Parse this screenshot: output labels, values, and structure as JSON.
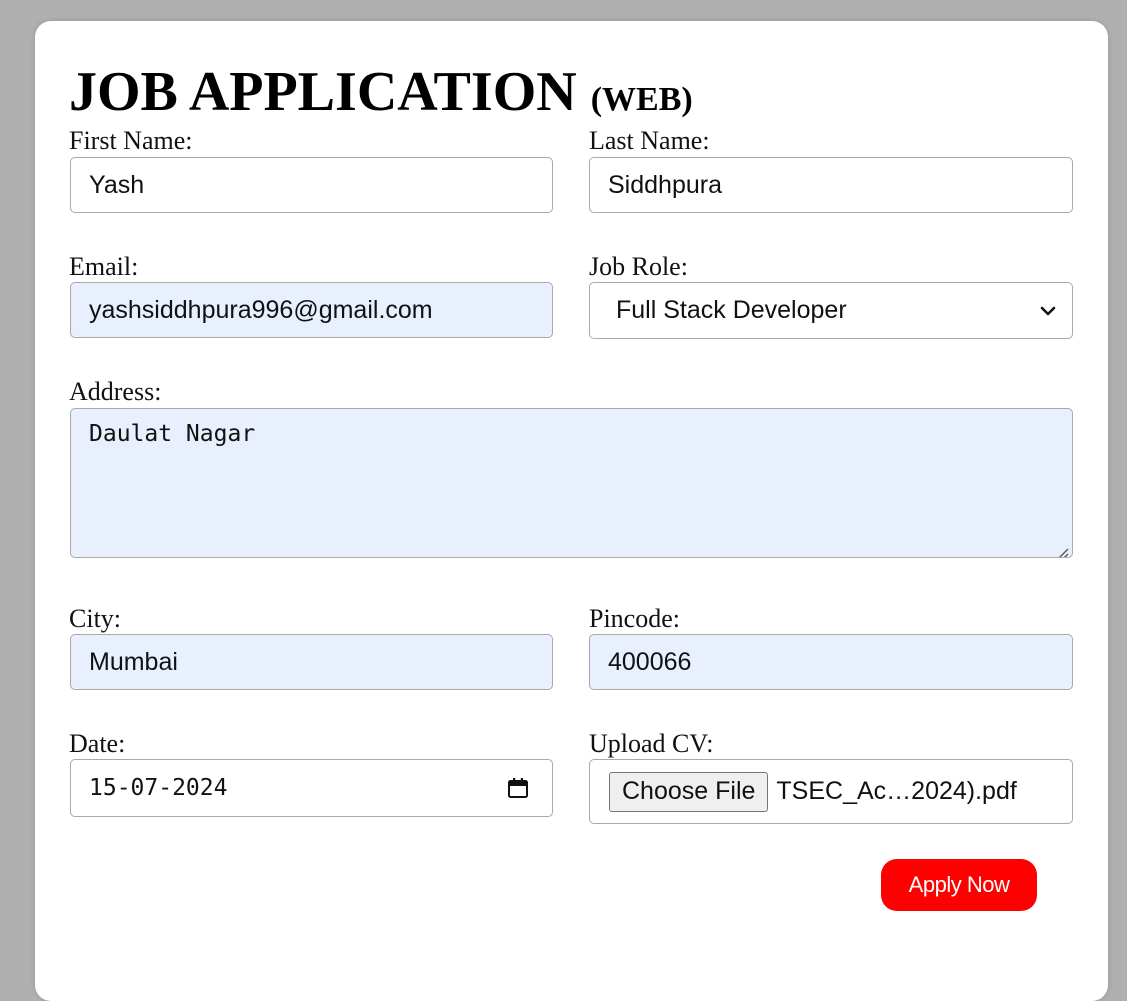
{
  "form": {
    "title": "JOB APPLICATION",
    "title_suffix": "(WEB)",
    "first_name": {
      "label": "First Name:",
      "value": "Yash"
    },
    "last_name": {
      "label": "Last Name:",
      "value": "Siddhpura"
    },
    "email": {
      "label": "Email:",
      "value": "yashsiddhpura996@gmail.com"
    },
    "job_role": {
      "label": "Job Role:",
      "selected": "Full Stack Developer"
    },
    "address": {
      "label": "Address:",
      "value": "Daulat Nagar"
    },
    "city": {
      "label": "City:",
      "value": "Mumbai"
    },
    "pincode": {
      "label": "Pincode:",
      "value": "400066"
    },
    "date": {
      "label": "Date:",
      "value": "15-07-2024"
    },
    "upload_cv": {
      "label": "Upload CV:",
      "button_label": "Choose File",
      "file_name": "TSEC_Ac…2024).pdf"
    },
    "submit_label": "Apply Now"
  },
  "colors": {
    "autofill_bg": "#e8f0fe",
    "submit_bg": "#ff0000",
    "page_bg": "#b1b0b1"
  },
  "icons": {
    "select_chevron": "chevron-down-icon",
    "date_picker": "calendar-icon",
    "textarea_resize": "resize-handle-icon"
  }
}
